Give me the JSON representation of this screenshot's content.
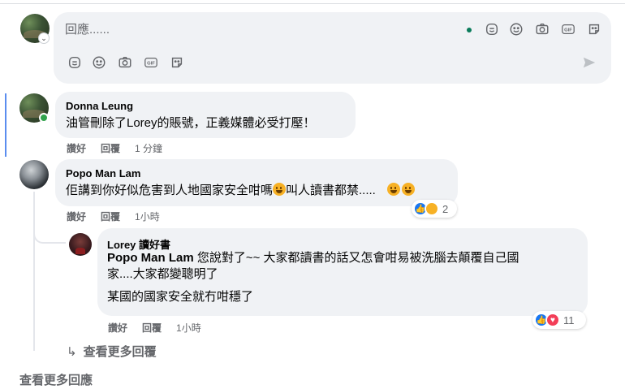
{
  "composer": {
    "placeholder": "回應......"
  },
  "comments": [
    {
      "author": "Donna Leung",
      "text": "油管刪除了Lorey的賬號，正義媒體必受打壓！",
      "like_label": "讚好",
      "reply_label": "回覆",
      "time": "1 分鐘"
    },
    {
      "author": "Popo Man Lam",
      "text": "佢講到你好似危害到人地國家安全咁嗎",
      "text_tail": "叫人讀書都禁.....",
      "like_label": "讚好",
      "reply_label": "回覆",
      "time": "1小時",
      "reaction_count": "2"
    }
  ],
  "reply": {
    "author": "Lorey 讀好書",
    "mention": "Popo Man Lam",
    "text_line1": "您說對了~~ 大家都讀書的話又怎會咁易被洗腦去顛覆自己國",
    "text_line2": "家....大家都變聰明了",
    "text_line3": "某國的國家安全就冇咁穩了",
    "like_label": "讚好",
    "reply_label": "回覆",
    "time": "1小時",
    "reaction_count": "11"
  },
  "links": {
    "more_replies": "查看更多回覆",
    "more_comments": "查看更多回應"
  },
  "colors": {
    "bubble": "#f0f2f5",
    "meta_text": "#65676b",
    "online": "#31a24c",
    "like_blue": "#1877f2",
    "love_red": "#f33e58",
    "haha_yellow": "#f7b125"
  }
}
